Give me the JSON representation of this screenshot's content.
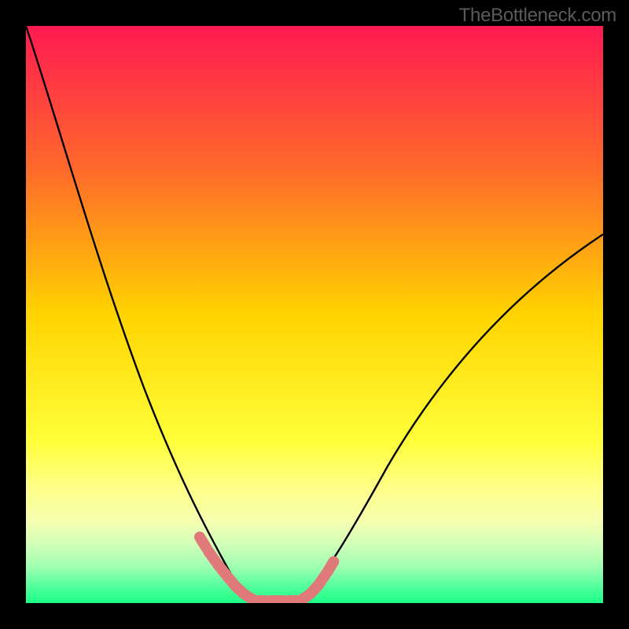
{
  "watermark": "TheBottleneck.com",
  "chart_data": {
    "type": "line",
    "title": "",
    "xlabel": "",
    "ylabel": "",
    "xlim": [
      0,
      100
    ],
    "ylim": [
      0,
      100
    ],
    "background_gradient": {
      "stops": [
        {
          "pos": 0,
          "color": "#ff1a52"
        },
        {
          "pos": 50,
          "color": "#ffd400"
        },
        {
          "pos": 78,
          "color": "#ffff55"
        },
        {
          "pos": 88,
          "color": "#e8ff9a"
        },
        {
          "pos": 95,
          "color": "#8affa0"
        },
        {
          "pos": 100,
          "color": "#1bff85"
        }
      ]
    },
    "series": [
      {
        "name": "left-curve",
        "stroke": "#000000",
        "x": [
          0,
          4,
          8,
          12,
          16,
          20,
          24,
          28,
          32,
          34,
          36,
          38
        ],
        "y": [
          100,
          81,
          64,
          49,
          37,
          27,
          19,
          12,
          6,
          4,
          2,
          1
        ]
      },
      {
        "name": "right-curve",
        "stroke": "#000000",
        "x": [
          48,
          50,
          53,
          57,
          63,
          70,
          78,
          86,
          94,
          100
        ],
        "y": [
          1,
          3,
          7,
          14,
          24,
          34,
          44,
          52,
          59,
          64
        ]
      },
      {
        "name": "valley-floor",
        "stroke": "#1bff85",
        "x": [
          38,
          48
        ],
        "y": [
          0,
          0
        ]
      },
      {
        "name": "marker-band-left",
        "stroke": "#e07a7a",
        "x": [
          30,
          31,
          32,
          33,
          34,
          35,
          36,
          37,
          38,
          39,
          40
        ],
        "y": [
          11,
          9,
          7.5,
          6,
          4.8,
          3.6,
          2.5,
          1.6,
          0.9,
          0.5,
          0.3
        ]
      },
      {
        "name": "marker-band-right",
        "stroke": "#e07a7a",
        "x": [
          45,
          46,
          47,
          48,
          49,
          50,
          51,
          52
        ],
        "y": [
          0.3,
          0.6,
          1,
          1.6,
          2.6,
          3.8,
          5.4,
          7.5
        ]
      },
      {
        "name": "marker-band-bottom",
        "stroke": "#e07a7a",
        "x": [
          39,
          40,
          41,
          42,
          43,
          44,
          45,
          46
        ],
        "y": [
          0.6,
          0.4,
          0.4,
          0.4,
          0.4,
          0.4,
          0.4,
          0.6
        ]
      }
    ]
  }
}
